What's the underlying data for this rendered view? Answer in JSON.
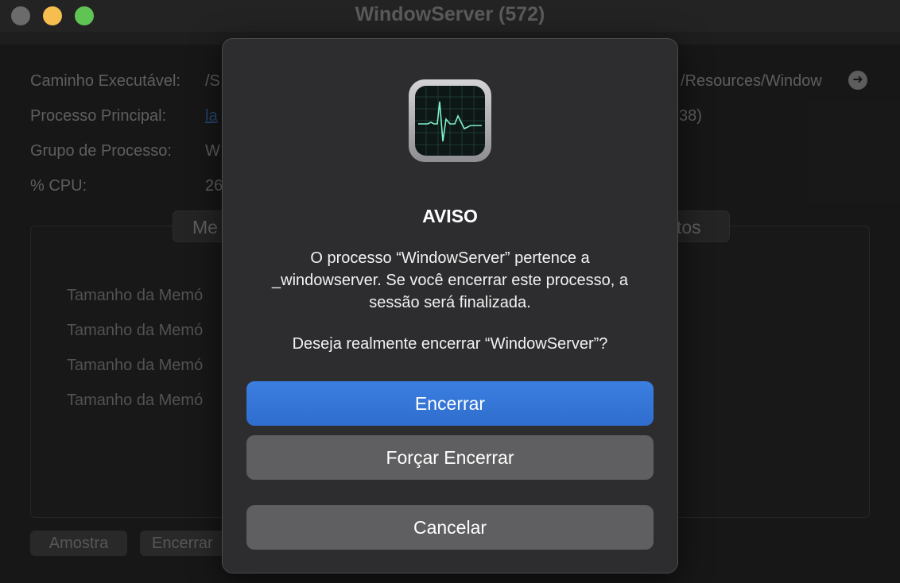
{
  "window": {
    "title": "WindowServer (572)"
  },
  "info": {
    "executable_path_label": "Caminho Executável:",
    "executable_path_value_start": "/S",
    "executable_path_value_end": "/Resources/Window",
    "parent_process_label": "Processo Principal:",
    "parent_process_value": "la",
    "parent_process_pid_fragment": "38)",
    "process_group_label": "Grupo de Processo:",
    "process_group_value": "W",
    "cpu_label": "% CPU:",
    "cpu_value": "26"
  },
  "tabs": {
    "left_fragment": "Me",
    "right_fragment": "tos"
  },
  "memory_rows": [
    "Tamanho da Memó",
    "Tamanho da Memó",
    "Tamanho da Memó",
    "Tamanho da Memó"
  ],
  "bottom_buttons": {
    "sample": "Amostra",
    "quit": "Encerrar"
  },
  "dialog": {
    "title": "AVISO",
    "message": "O processo “WindowServer” pertence a _windowserver. Se você encerrar este processo, a sessão será finalizada.",
    "question": "Deseja realmente encerrar “WindowServer”?",
    "quit_label": "Encerrar",
    "force_quit_label": "Forçar Encerrar",
    "cancel_label": "Cancelar"
  },
  "icons": {
    "app_icon": "activity-monitor-icon",
    "path_arrow": "arrow-right-circle-icon"
  },
  "colors": {
    "accent": "#3b7fe0",
    "close": "#6b6b6b",
    "minimize": "#f6be4f",
    "maximize": "#5fc453"
  }
}
